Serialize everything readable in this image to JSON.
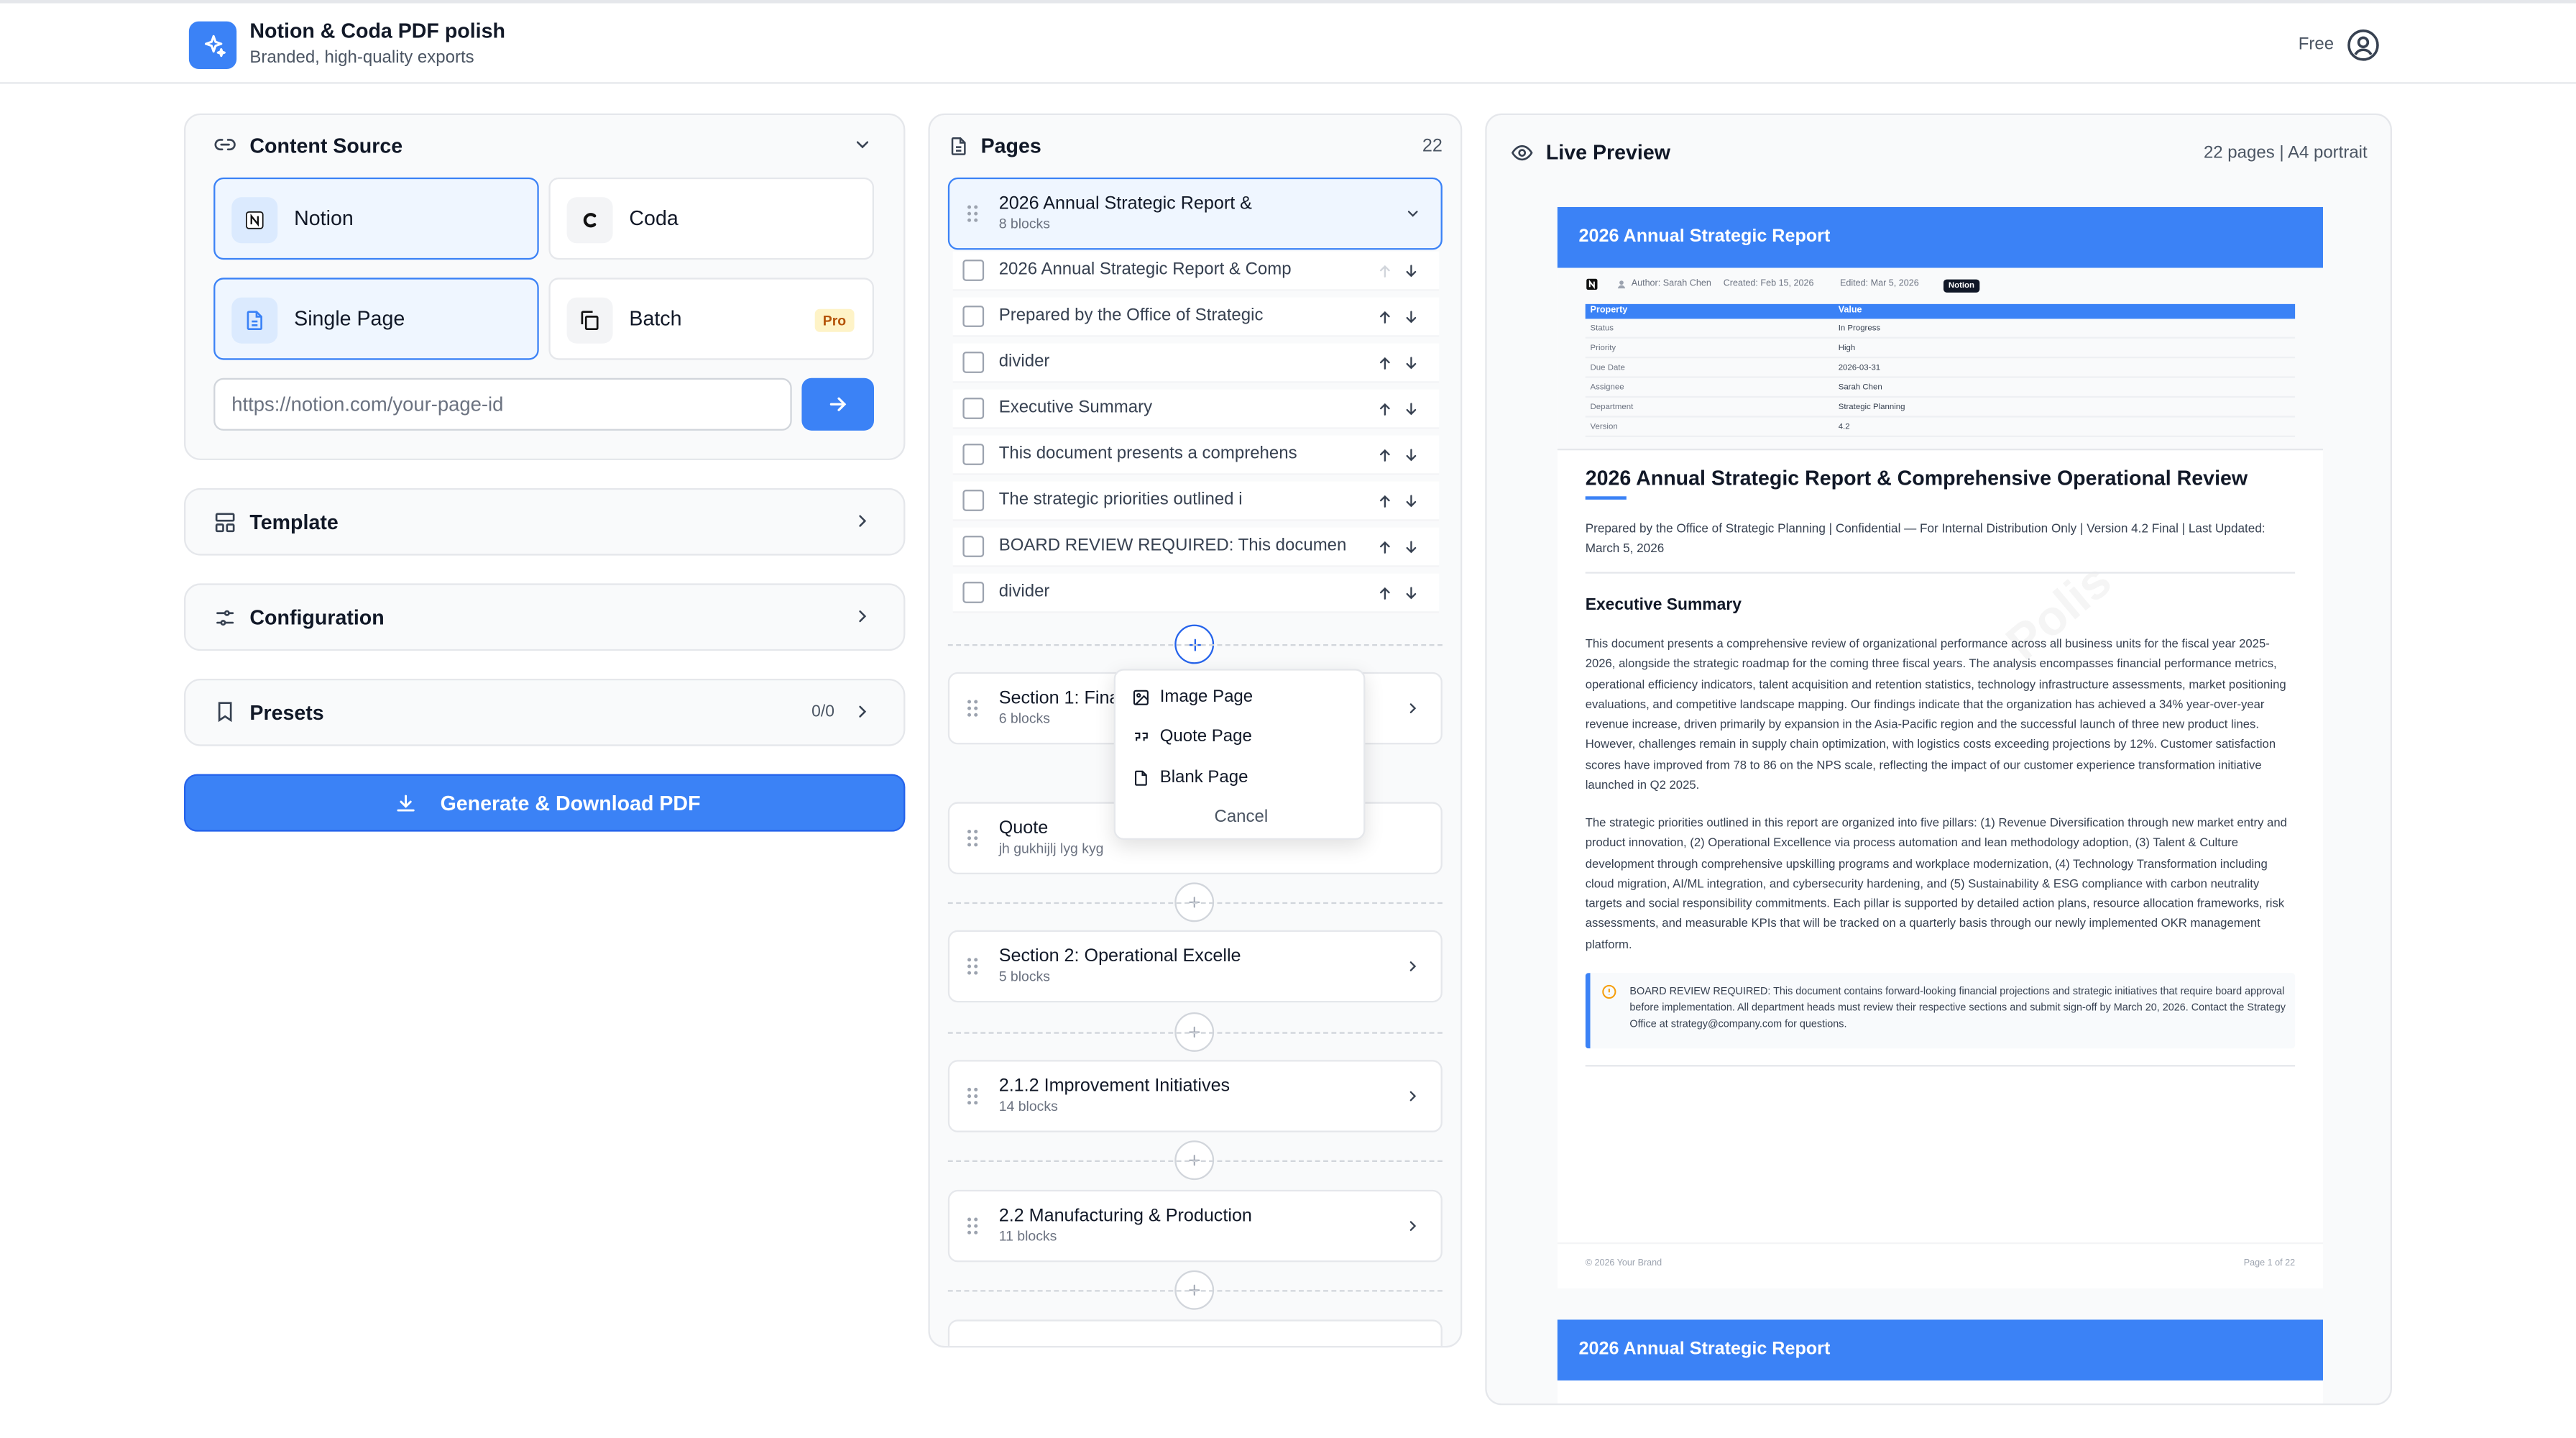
{
  "app": {
    "title": "Notion & Coda PDF polish",
    "subtitle": "Branded, high-quality exports",
    "plan": "Free"
  },
  "source": {
    "title": "Content Source",
    "providers": [
      "Notion",
      "Coda"
    ],
    "modes": [
      "Single Page",
      "Batch"
    ],
    "pro_badge": "Pro",
    "url_placeholder": "https://notion.com/your-page-id"
  },
  "sections": {
    "template": "Template",
    "configuration": "Configuration",
    "presets": "Presets",
    "presets_count": "0/0"
  },
  "generate_label": "Generate & Download PDF",
  "pages": {
    "title": "Pages",
    "count": "22",
    "open_section": {
      "name": "2026 Annual Strategic Report &",
      "blocks": "8 blocks"
    },
    "blocks": [
      "2026 Annual Strategic Report & Comp",
      "Prepared by the Office of Strategic",
      "divider",
      "Executive Summary",
      "This document presents a comprehens",
      "The strategic priorities outlined i",
      "BOARD REVIEW REQUIRED: This documen",
      "divider"
    ],
    "sections": [
      {
        "name": "Section 1: Fina",
        "blocks": "6 blocks"
      },
      {
        "name": "Quote",
        "blocks": "jh gukhijlj lyg kyg"
      },
      {
        "name": "Section 2: Operational Excelle",
        "blocks": "5 blocks"
      },
      {
        "name": "2.1.2 Improvement Initiatives",
        "blocks": "14 blocks"
      },
      {
        "name": "2.2 Manufacturing & Production",
        "blocks": "11 blocks"
      }
    ],
    "add_menu": {
      "items": [
        "Image Page",
        "Quote Page",
        "Blank Page"
      ],
      "cancel": "Cancel"
    }
  },
  "preview": {
    "title": "Live Preview",
    "meta": "22 pages | A4 portrait",
    "banner": "2026 Annual Strategic Report",
    "doc_meta": {
      "author": "Author: Sarah Chen",
      "created": "Created: Feb 15, 2026",
      "edited": "Edited: Mar 5, 2026",
      "badge": "Notion"
    },
    "props_header": [
      "Property",
      "Value"
    ],
    "props": [
      [
        "Status",
        "In Progress"
      ],
      [
        "Priority",
        "High"
      ],
      [
        "Due Date",
        "2026-03-31"
      ],
      [
        "Assignee",
        "Sarah Chen"
      ],
      [
        "Department",
        "Strategic Planning"
      ],
      [
        "Version",
        "4.2"
      ]
    ],
    "h1": "2026 Annual Strategic Report & Comprehensive Operational Review",
    "byline": "Prepared by the Office of Strategic Planning | Confidential — For Internal Distribution Only | Version 4.2 Final | Last Updated: March 5, 2026",
    "h2": "Executive Summary",
    "p1": "This document presents a comprehensive review of organizational performance across all business units for the fiscal year 2025-2026, alongside the strategic roadmap for the coming three fiscal years. The analysis encompasses financial performance metrics, operational efficiency indicators, talent acquisition and retention statistics, technology infrastructure assessments, market positioning evaluations, and competitive landscape mapping. Our findings indicate that the organization has achieved a 34% year-over-year revenue increase, driven primarily by expansion in the Asia-Pacific region and the successful launch of three new product lines. However, challenges remain in supply chain optimization, with logistics costs exceeding projections by 12%. Customer satisfaction scores have improved from 78 to 86 on the NPS scale, reflecting the impact of our customer experience transformation initiative launched in Q2 2025.",
    "p2": "The strategic priorities outlined in this report are organized into five pillars: (1) Revenue Diversification through new market entry and product innovation, (2) Operational Excellence via process automation and lean methodology adoption, (3) Talent & Culture development through comprehensive upskilling programs and workplace modernization, (4) Technology Transformation including cloud migration, AI/ML integration, and cybersecurity hardening, and (5) Sustainability & ESG compliance with carbon neutrality targets and social responsibility commitments. Each pillar is supported by detailed action plans, resource allocation frameworks, risk assessments, and measurable KPIs that will be tracked on a quarterly basis through our newly implemented OKR management platform.",
    "callout": "BOARD REVIEW REQUIRED: This document contains forward-looking financial projections and strategic initiatives that require board approval before implementation. All department heads must review their respective sections and submit sign-off by March 20, 2026. Contact the Strategy Office at strategy@company.com for questions.",
    "footer_left": "© 2026 Your Brand",
    "footer_right": "Page 1 of 22",
    "watermark": "Polis",
    "banner2": "2026 Annual Strategic Report"
  },
  "colors": {
    "accent": "#3b82f6",
    "pro": "#b45309"
  }
}
